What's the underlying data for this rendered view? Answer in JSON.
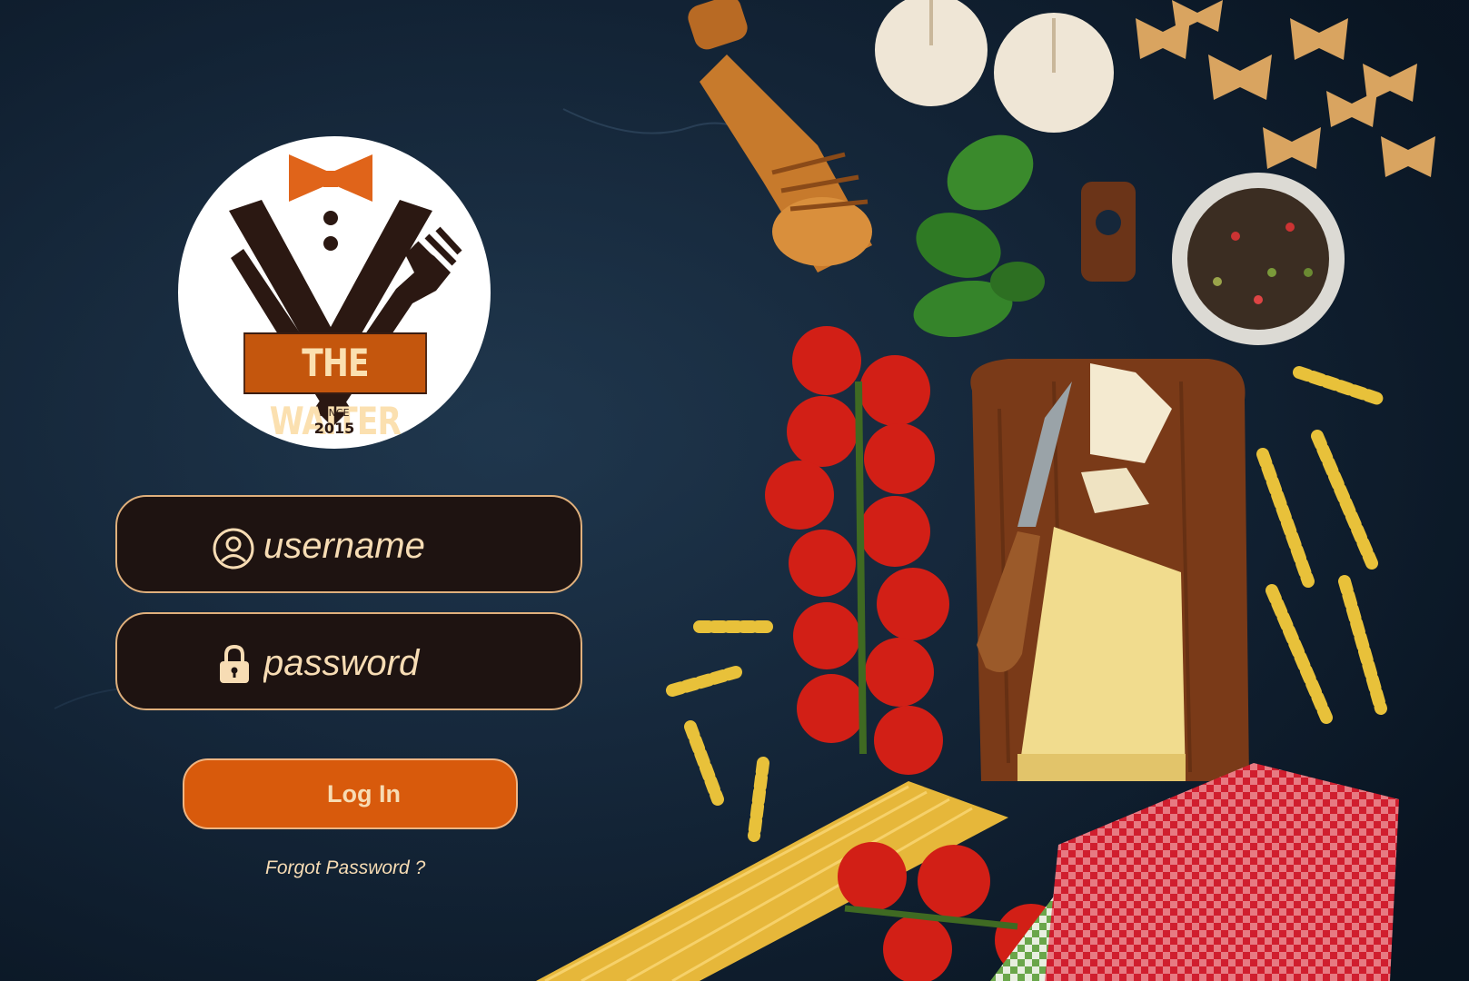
{
  "brand": {
    "name": "THE WAITER",
    "since_label": "SINCE",
    "since_year": "2015",
    "colors": {
      "orange": "#c4560d",
      "dark_brown": "#2b1812",
      "cream": "#fbe0b0"
    }
  },
  "login_form": {
    "username": {
      "icon": "user-circle-icon",
      "placeholder": "username",
      "value": ""
    },
    "password": {
      "icon": "lock-icon",
      "placeholder": "password",
      "value": ""
    },
    "login_button_label": "Log In",
    "forgot_password_label": "Forgot Password ?"
  },
  "theme": {
    "field_background": "#1e1311",
    "field_border": "#e0b07c",
    "text_color": "#f7dcb4",
    "button_color": "#d85a0c"
  }
}
